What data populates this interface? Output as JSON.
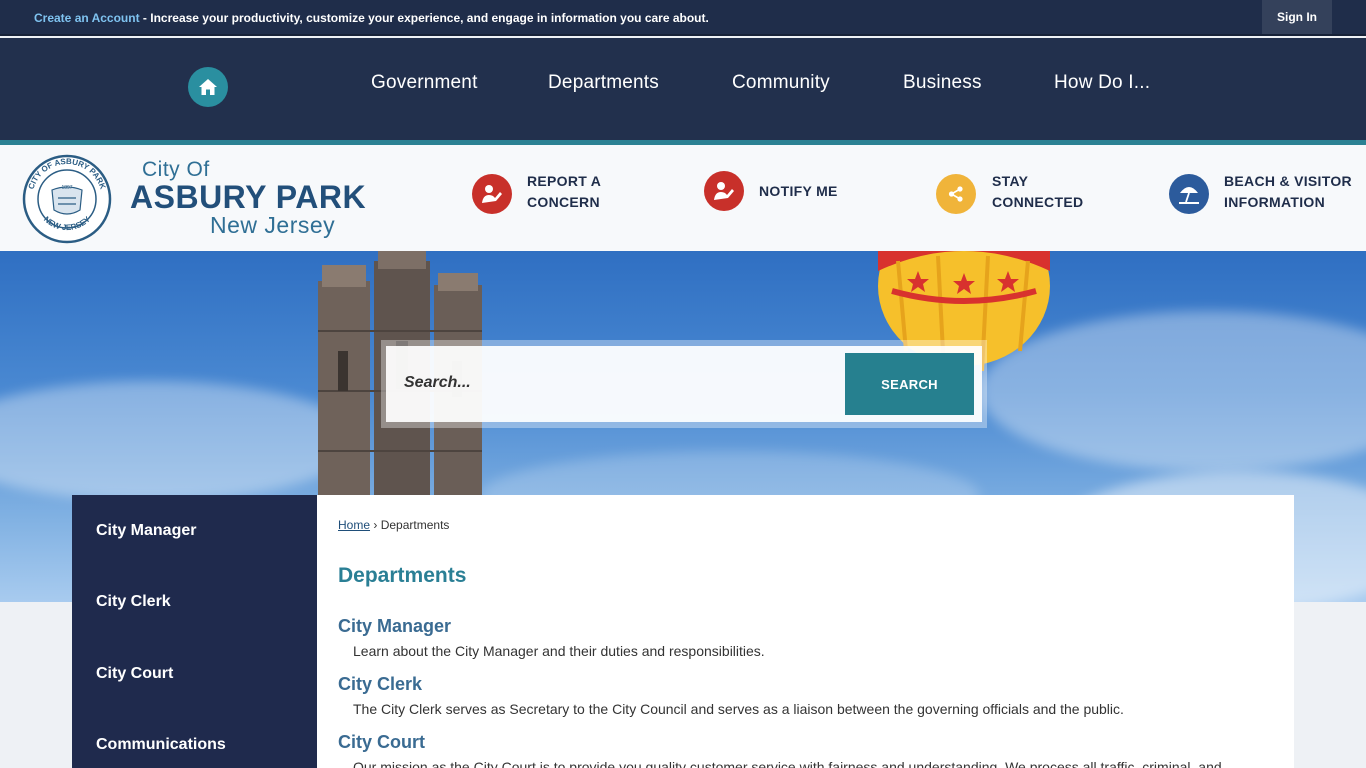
{
  "account_bar": {
    "create_link": "Create an Account",
    "message": " - Increase your productivity, customize your experience, and engage in information you care about.",
    "sign_in": "Sign In"
  },
  "nav": {
    "home_icon": "home-icon",
    "items": [
      "Government",
      "Departments",
      "Community",
      "Business",
      "How Do I..."
    ]
  },
  "brand": {
    "line1": "City Of",
    "line2": "ASBURY PARK",
    "line3": "New Jersey",
    "seal_text_top": "CITY OF ASBURY PARK",
    "seal_text_bottom": "NEW JERSEY",
    "seal_year": "1897"
  },
  "quicklinks": [
    {
      "line1": "REPORT A",
      "line2": "CONCERN",
      "icon": "report-concern-icon",
      "color": "#c8302a"
    },
    {
      "line1": "NOTIFY ME",
      "line2": "",
      "icon": "notify-me-icon",
      "color": "#c8302a"
    },
    {
      "line1": "STAY",
      "line2": "CONNECTED",
      "icon": "share-icon",
      "color": "#f0b43a"
    },
    {
      "line1": "BEACH & VISITOR",
      "line2": "INFORMATION",
      "icon": "beach-umbrella-icon",
      "color": "#2c5b9c"
    }
  ],
  "search": {
    "placeholder": "Search...",
    "button": "SEARCH"
  },
  "side_nav": [
    "City Manager",
    "City Clerk",
    "City Court",
    "Communications"
  ],
  "breadcrumb": {
    "home": "Home",
    "separator": "›",
    "current": "Departments"
  },
  "page_title": "Departments",
  "departments": [
    {
      "title": "City Manager",
      "desc": "Learn about the City Manager and their duties and responsibilities."
    },
    {
      "title": "City Clerk",
      "desc": "The City Clerk serves as Secretary to the City Council and serves as a liaison between the governing officials and the public."
    },
    {
      "title": "City Court",
      "desc": "Our mission as the City Court is to provide you quality customer service with fairness and understanding. We process all traffic, criminal, and"
    }
  ],
  "colors": {
    "navy": "#22304d",
    "teal": "#2a8fa0",
    "accent_red": "#c8302a",
    "accent_gold": "#f0b43a"
  }
}
